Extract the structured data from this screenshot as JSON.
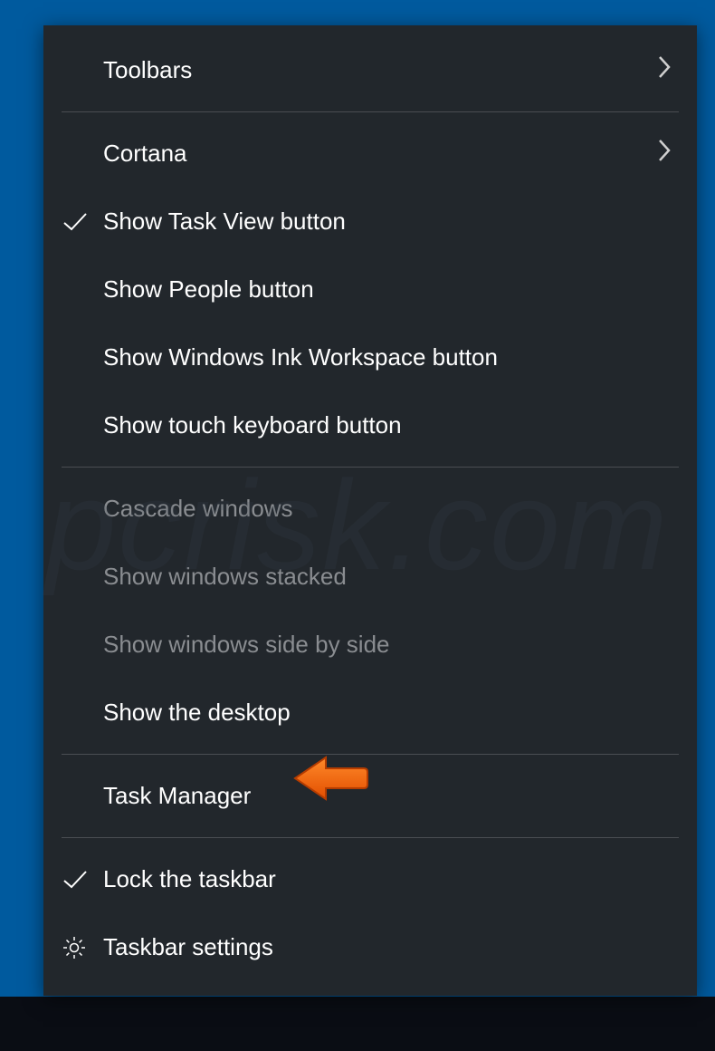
{
  "watermark_text": "pcrisk.com",
  "menu": {
    "items": [
      {
        "label": "Toolbars",
        "submenu": true,
        "checked": false,
        "disabled": false,
        "icon": null
      },
      {
        "separator": true
      },
      {
        "label": "Cortana",
        "submenu": true,
        "checked": false,
        "disabled": false,
        "icon": null
      },
      {
        "label": "Show Task View button",
        "submenu": false,
        "checked": true,
        "disabled": false,
        "icon": null
      },
      {
        "label": "Show People button",
        "submenu": false,
        "checked": false,
        "disabled": false,
        "icon": null
      },
      {
        "label": "Show Windows Ink Workspace button",
        "submenu": false,
        "checked": false,
        "disabled": false,
        "icon": null
      },
      {
        "label": "Show touch keyboard button",
        "submenu": false,
        "checked": false,
        "disabled": false,
        "icon": null
      },
      {
        "separator": true
      },
      {
        "label": "Cascade windows",
        "submenu": false,
        "checked": false,
        "disabled": true,
        "icon": null
      },
      {
        "label": "Show windows stacked",
        "submenu": false,
        "checked": false,
        "disabled": true,
        "icon": null
      },
      {
        "label": "Show windows side by side",
        "submenu": false,
        "checked": false,
        "disabled": true,
        "icon": null
      },
      {
        "label": "Show the desktop",
        "submenu": false,
        "checked": false,
        "disabled": false,
        "icon": null
      },
      {
        "separator": true
      },
      {
        "label": "Task Manager",
        "submenu": false,
        "checked": false,
        "disabled": false,
        "icon": null,
        "highlighted": true
      },
      {
        "separator": true
      },
      {
        "label": "Lock the taskbar",
        "submenu": false,
        "checked": true,
        "disabled": false,
        "icon": null
      },
      {
        "label": "Taskbar settings",
        "submenu": false,
        "checked": false,
        "disabled": false,
        "icon": "gear"
      }
    ]
  },
  "annotation": {
    "type": "arrow-left",
    "color": "#ff6a13"
  }
}
